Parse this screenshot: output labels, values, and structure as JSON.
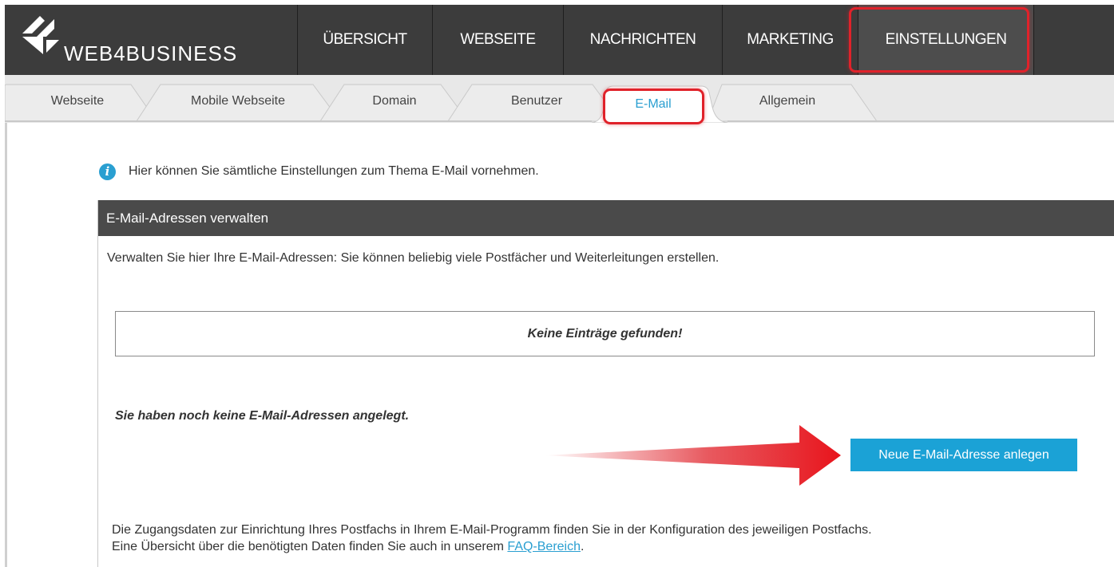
{
  "brand": {
    "logo_text": "WEB4BUSINESS",
    "nav_bg": "#3c3c3c",
    "accent": "#2a9fd1",
    "highlight": "#e0222a"
  },
  "nav": {
    "items": [
      {
        "label": "ÜBERSICHT"
      },
      {
        "label": "WEBSEITE"
      },
      {
        "label": "NACHRICHTEN"
      },
      {
        "label": "MARKETING"
      },
      {
        "label": "EINSTELLUNGEN",
        "active": true
      }
    ]
  },
  "tabs": {
    "items": [
      {
        "label": "Webseite"
      },
      {
        "label": "Mobile Webseite"
      },
      {
        "label": "Domain"
      },
      {
        "label": "Benutzer"
      },
      {
        "label": "E-Mail",
        "active": true
      },
      {
        "label": "Allgemein"
      }
    ]
  },
  "info": {
    "icon": "info-icon",
    "text": "Hier können Sie sämtliche Einstellungen zum Thema E-Mail vornehmen."
  },
  "panel": {
    "title": "E-Mail-Adressen verwalten",
    "description": "Verwalten Sie hier Ihre E-Mail-Adressen: Sie können beliebig viele Postfächer und Weiterleitungen erstellen.",
    "empty_message": "Keine Einträge gefunden!",
    "none_message": "Sie haben noch keine E-Mail-Adressen angelegt.",
    "new_button": "Neue E-Mail-Adresse anlegen",
    "footer_line1": "Die Zugangsdaten zur Einrichtung Ihres Postfachs in Ihrem E-Mail-Programm finden Sie in der Konfiguration des jeweiligen Postfachs.",
    "footer_line2_prefix": "Eine Übersicht über die benötigten Daten finden Sie auch in unserem ",
    "faq_link": "FAQ-Bereich",
    "footer_line2_suffix": "."
  }
}
